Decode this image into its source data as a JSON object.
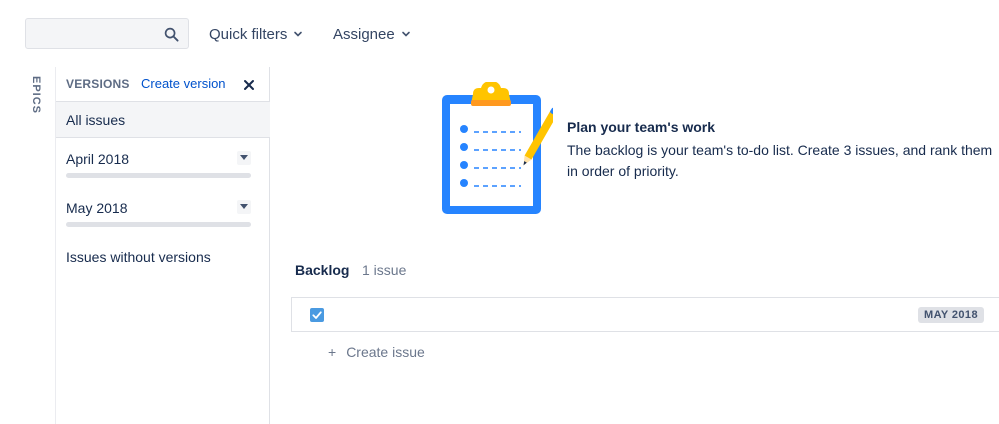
{
  "toolbar": {
    "search_value": "",
    "search_placeholder": "",
    "quick_filters_label": "Quick filters",
    "assignee_label": "Assignee"
  },
  "epics_tab": {
    "label": "EPICS"
  },
  "versions_panel": {
    "title": "VERSIONS",
    "create_label": "Create version",
    "all_issues_label": "All issues",
    "versions": [
      {
        "name": "April 2018",
        "progress": 0
      },
      {
        "name": "May 2018",
        "progress": 0
      }
    ],
    "without_versions_label": "Issues without versions"
  },
  "empty_state": {
    "title": "Plan your team's work",
    "description": "The backlog is your team's to-do list. Create 3 issues, and rank them in order of priority."
  },
  "backlog": {
    "title": "Backlog",
    "count_label": "1 issue",
    "issue": {
      "checked": true,
      "version_badge": "MAY 2018"
    },
    "create_issue_label": "Create issue",
    "create_issue_icon": "+"
  },
  "colors": {
    "link": "#0052cc",
    "checkbox": "#4a9ae1",
    "illustration_blue": "#2684ff",
    "illustration_yellow": "#ffc400"
  }
}
